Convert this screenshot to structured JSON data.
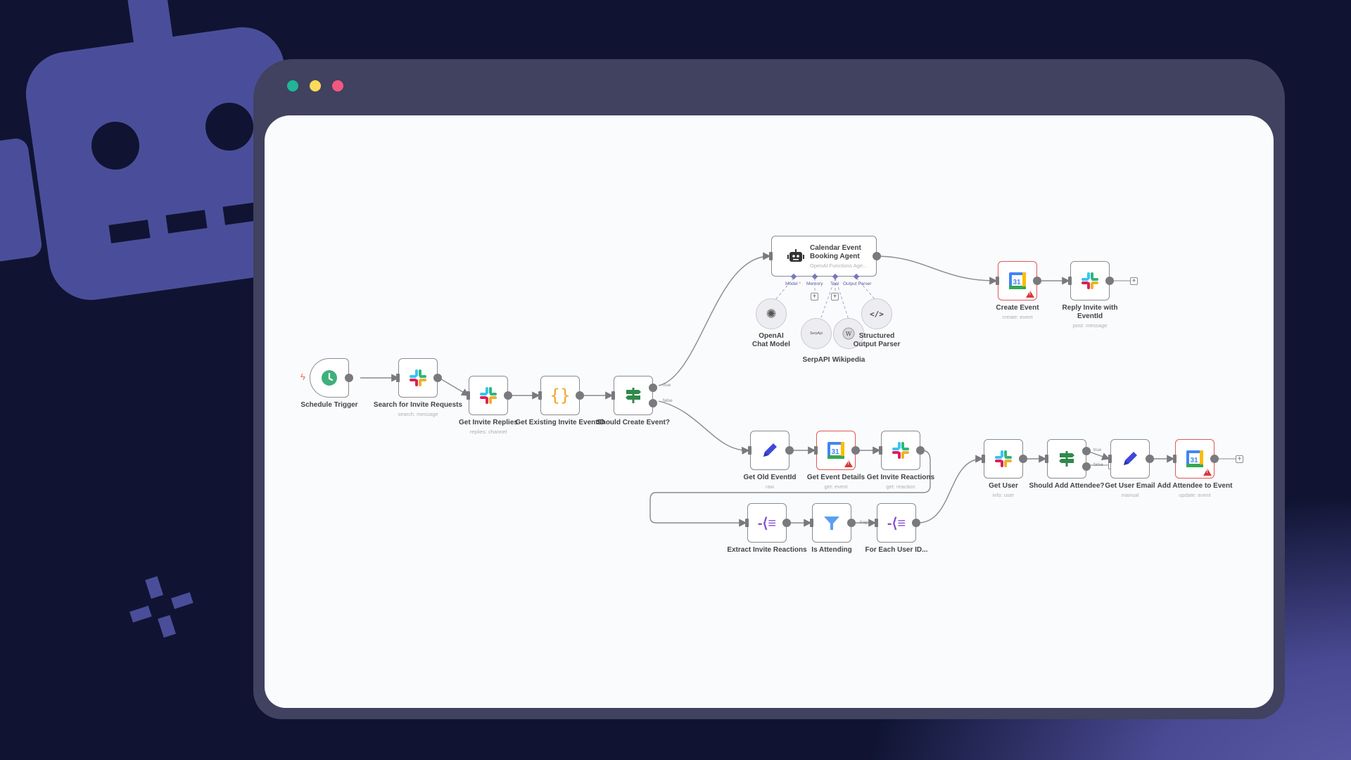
{
  "window": {
    "controls": [
      {
        "name": "close",
        "color": "#21b597"
      },
      {
        "name": "minimize",
        "color": "#fbd95a"
      },
      {
        "name": "maximize",
        "color": "#f2587f"
      }
    ]
  },
  "colors": {
    "background": "#101432",
    "decoration": "#4a4e9a",
    "window_frame": "#414160",
    "canvas": "#fafbfd",
    "node_border": "#8c8c90",
    "error_border": "#e0595b",
    "connector": "#7a7a7e",
    "sub_connector": "#7878b8"
  },
  "workflow": {
    "nodes": {
      "schedule_trigger": {
        "label": "Schedule Trigger",
        "sub": "",
        "icon": "clock-icon"
      },
      "search_invite_requests": {
        "label": "Search for Invite Requests",
        "sub": "search: message",
        "icon": "slack-icon"
      },
      "get_invite_replies": {
        "label": "Get Invite Replies",
        "sub": "replies: channel",
        "icon": "slack-icon"
      },
      "get_existing_invite_eventid": {
        "label": "Get Existing Invite EventID",
        "sub": "",
        "icon": "code-braces-icon"
      },
      "should_create_event": {
        "label": "Should Create Event?",
        "sub": "",
        "icon": "signpost-icon",
        "outputs": [
          "true",
          "false"
        ]
      },
      "calendar_agent": {
        "title": "Calendar Event Booking Agent",
        "sub": "OpenAI Functions Age...",
        "icon": "robot-icon",
        "ports": [
          "Model",
          "Memory",
          "Tool",
          "Output Parser"
        ],
        "required_mark": "*"
      },
      "openai_chat_model": {
        "label": "OpenAI Chat Model",
        "icon": "openai-icon"
      },
      "serpapi": {
        "label": "SerpAPI",
        "icon_text": "SerpApi",
        "icon": "serpapi-icon"
      },
      "wikipedia": {
        "label": "Wikipedia",
        "icon": "wikipedia-icon"
      },
      "structured_output_parser": {
        "label": "Structured Output Parser",
        "icon": "code-tag-icon"
      },
      "create_event": {
        "label": "Create Event",
        "sub": "create: event",
        "icon": "google-calendar-icon",
        "calendar_day": "31",
        "error": true
      },
      "reply_invite_with_eventid": {
        "label": "Reply Invite with EventId",
        "sub": "post: message",
        "icon": "slack-icon"
      },
      "get_old_eventid": {
        "label": "Get Old EventId",
        "sub": "raw",
        "icon": "pencil-icon"
      },
      "get_event_details": {
        "label": "Get Event Details",
        "sub": "get: event",
        "icon": "google-calendar-icon",
        "calendar_day": "31",
        "error": true
      },
      "get_invite_reactions": {
        "label": "Get Invite Reactions",
        "sub": "get: reaction",
        "icon": "slack-icon"
      },
      "extract_invite_reactions": {
        "label": "Extract Invite Reactions",
        "sub": "",
        "icon": "split-out-icon"
      },
      "is_attending": {
        "label": "Is Attending",
        "sub": "",
        "icon": "filter-icon",
        "output_label": "Kept"
      },
      "for_each_user_id": {
        "label": "For Each User ID...",
        "sub": "",
        "icon": "split-out-icon"
      },
      "get_user": {
        "label": "Get User",
        "sub": "info: user",
        "icon": "slack-icon"
      },
      "should_add_attendee": {
        "label": "Should Add Attendee?",
        "sub": "",
        "icon": "signpost-icon",
        "outputs": [
          "true",
          "false"
        ]
      },
      "get_user_email": {
        "label": "Get User Email",
        "sub": "manual",
        "icon": "pencil-icon"
      },
      "add_attendee_to_event": {
        "label": "Add Attendee to Event",
        "sub": "update: event",
        "icon": "google-calendar-icon",
        "calendar_day": "31",
        "error": true
      }
    },
    "add_button": "+"
  }
}
